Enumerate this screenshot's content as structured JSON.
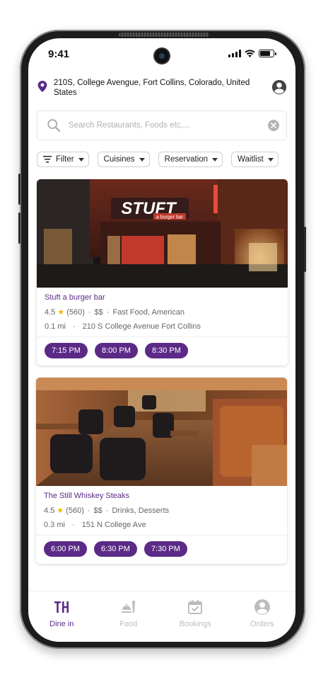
{
  "status_bar": {
    "time": "9:41"
  },
  "location": {
    "address": "210S, College Avengue, Fort Collins, Colorado, United States"
  },
  "search": {
    "placeholder": "Search Restaurants, Foods etc,..."
  },
  "filters": [
    {
      "label": "Filter"
    },
    {
      "label": "Cuisines"
    },
    {
      "label": "Reservation"
    },
    {
      "label": "Waitlist"
    }
  ],
  "restaurants": [
    {
      "name": "Stuft a burger bar",
      "rating": "4.5",
      "reviews": "(560)",
      "price": "$$",
      "cuisines": "Fast Food, American",
      "distance": "0.1 mi",
      "address": "210 S College Avenue Fort Collins",
      "slots": [
        "7:15 PM",
        "8:00 PM",
        "8:30 PM"
      ],
      "sign_text": "STUFT",
      "sign_sub": "a burger bar"
    },
    {
      "name": "The Still Whiskey Steaks",
      "rating": "4.5",
      "reviews": "(560)",
      "price": "$$",
      "cuisines": "Drinks, Desserts",
      "distance": "0.3 mi",
      "address": "151 N College Ave",
      "slots": [
        "6:00 PM",
        "6:30 PM",
        "7:30 PM"
      ]
    }
  ],
  "bottom_nav": [
    {
      "label": "Dine in",
      "icon": "dine-in-icon",
      "active": true
    },
    {
      "label": "Food",
      "icon": "food-icon",
      "active": false
    },
    {
      "label": "Bookings",
      "icon": "calendar-check-icon",
      "active": false
    },
    {
      "label": "Orders",
      "icon": "account-circle-icon",
      "active": false
    }
  ],
  "colors": {
    "accent": "#5b2a86",
    "star": "#f4b400"
  }
}
